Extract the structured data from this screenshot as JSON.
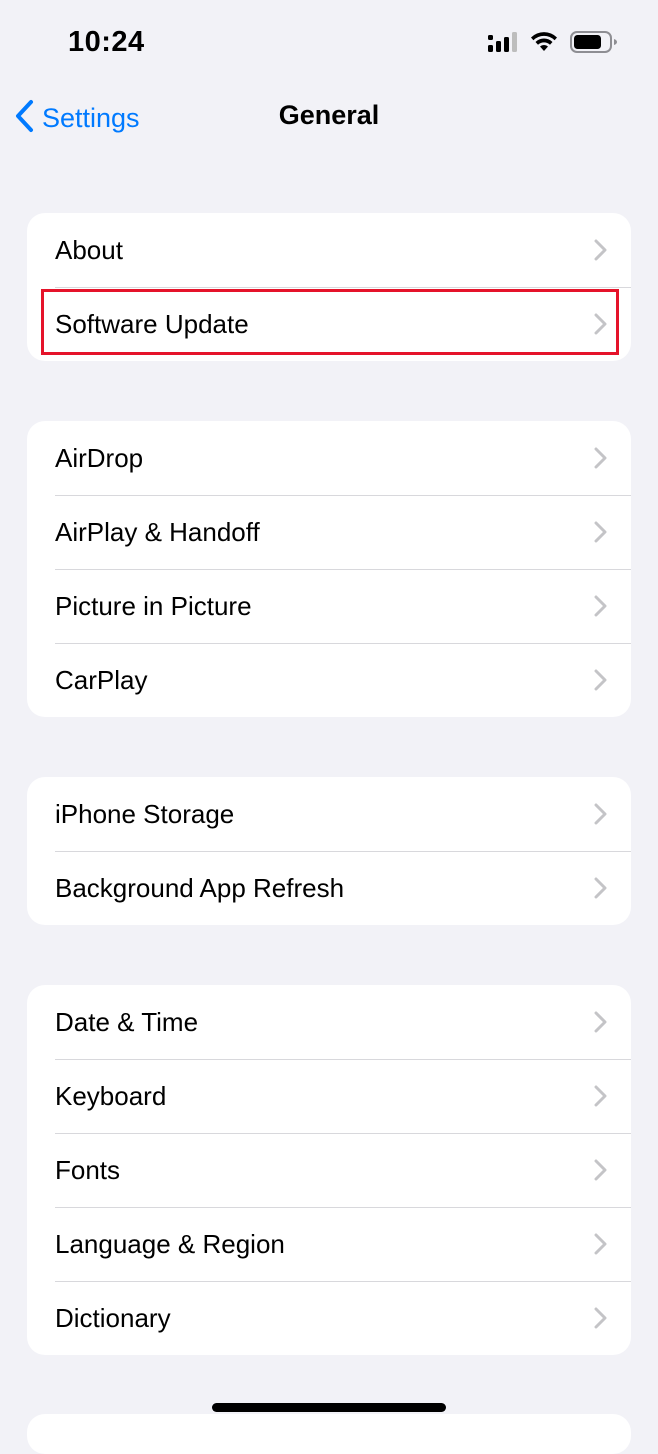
{
  "status_bar": {
    "time": "10:24",
    "icons": [
      "cellular-signal-icon",
      "wifi-icon",
      "battery-icon"
    ],
    "battery_level": 0.75
  },
  "nav": {
    "back_label": "Settings",
    "title": "General"
  },
  "groups": [
    {
      "items": [
        {
          "label": "About"
        },
        {
          "label": "Software Update",
          "highlighted": true
        }
      ]
    },
    {
      "items": [
        {
          "label": "AirDrop"
        },
        {
          "label": "AirPlay & Handoff"
        },
        {
          "label": "Picture in Picture"
        },
        {
          "label": "CarPlay"
        }
      ]
    },
    {
      "items": [
        {
          "label": "iPhone Storage"
        },
        {
          "label": "Background App Refresh"
        }
      ]
    },
    {
      "items": [
        {
          "label": "Date & Time"
        },
        {
          "label": "Keyboard"
        },
        {
          "label": "Fonts"
        },
        {
          "label": "Language & Region"
        },
        {
          "label": "Dictionary"
        }
      ]
    }
  ],
  "colors": {
    "accent": "#007aff",
    "background": "#f2f2f7",
    "highlight": "#e5132a",
    "chevron": "#c4c4c7"
  }
}
